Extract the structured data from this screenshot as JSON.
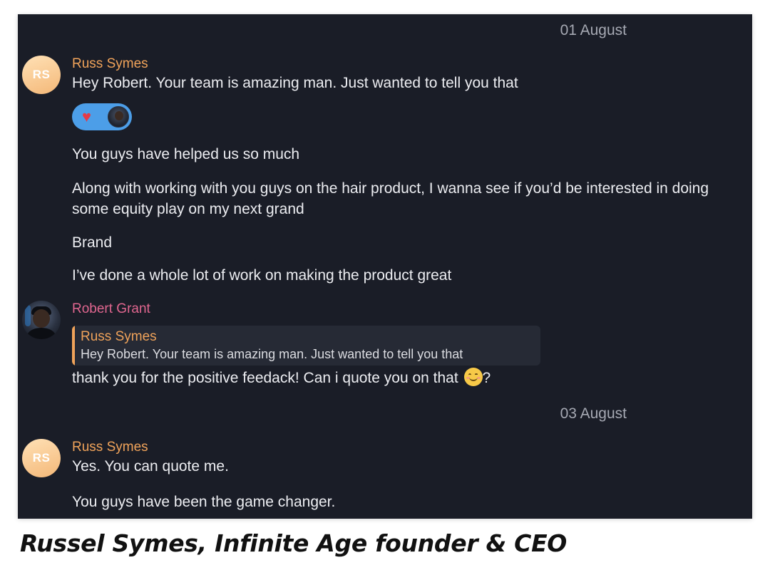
{
  "chat": {
    "groups": [
      {
        "date": "01 August",
        "messages": [
          {
            "sender": "Russ Symes",
            "initials": "RS",
            "lines": [
              "Hey Robert. Your team is amazing man. Just wanted to tell you that",
              "You guys have helped us so much",
              "Along with working with you guys on the hair product, I wanna see if you’d be interested in doing some equity play on my next grand",
              "Brand",
              "I’ve done a whole lot of work on making the product great"
            ],
            "reaction": {
              "emoji": "heart-icon"
            }
          },
          {
            "sender": "Robert Grant",
            "reply_to": {
              "sender": "Russ Symes",
              "text": "Hey Robert. Your team is amazing man. Just wanted to tell you that"
            },
            "text_before_emoji": "thank you for the positive feedack! Can i quote you on that ",
            "emoji": "smiling-face-icon",
            "text_after_emoji": "?"
          }
        ]
      },
      {
        "date": "03 August",
        "messages": [
          {
            "sender": "Russ Symes",
            "initials": "RS",
            "lines": [
              "Yes. You can quote me.",
              "You guys have been the game changer."
            ]
          }
        ]
      }
    ]
  },
  "caption": "Russel Symes, Infinite Age founder & CEO",
  "colors": {
    "background": "#1a1d27",
    "russ_name": "#f0a35a",
    "robert_name": "#e0668f",
    "reaction_pill": "#4c9ee8"
  }
}
